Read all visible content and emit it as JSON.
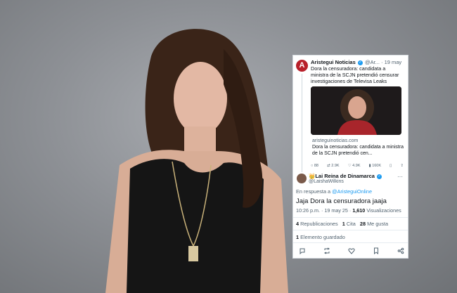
{
  "tweet1": {
    "avatar_letter": "A",
    "name": "Aristegui Noticias",
    "handle": "@Ar...",
    "date": "· 19 may",
    "text": "Dora la censuradora: candidata a ministra de la SCJN pretendió censurar investigaciones de Televisa Leaks",
    "link_domain": "aristeguinoticias.com",
    "link_title": "Dora la censuradora: candidata a ministra de la SCJN pretendió cen...",
    "actions": {
      "replies": "88",
      "retweets": "2.9K",
      "likes": "4.9K",
      "views": "160K"
    }
  },
  "tweet2": {
    "name": "Lai Reina de Dinamarca",
    "handle": "@LaishaWilkins",
    "more": "···",
    "reply_prefix": "En respuesta a",
    "reply_to": "@AristeguiOnline",
    "text": "Jaja Dora la censuradora jaaja",
    "time": "10:26 p.m. · 19 may 25 ·",
    "views_count": "1,610",
    "views_label": "Visualizaciones",
    "reposts_count": "4",
    "reposts_label": "Republicaciones",
    "quotes_count": "1",
    "quotes_label": "Cita",
    "likes_count": "28",
    "likes_label": "Me gusta",
    "saved_count": "1",
    "saved_label": "Elemento guardado"
  },
  "colors": {
    "accent": "#1d9bf0",
    "brand": "#b8202a",
    "muted": "#536471"
  }
}
